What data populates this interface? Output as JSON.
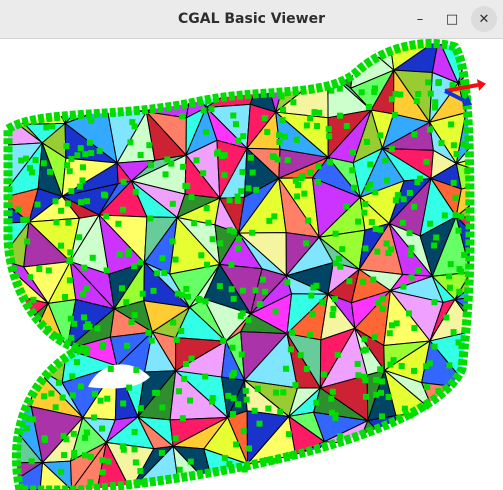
{
  "window": {
    "title": "CGAL Basic Viewer",
    "minimize_glyph": "–",
    "maximize_glyph": "□",
    "close_glyph": "✕"
  },
  "scene": {
    "background": "#ffffff",
    "mesh_edge_color": "#000000",
    "vertex_color": "#00dd00",
    "axes": {
      "x_color": "#ee1111",
      "y_color": "#1133dd"
    }
  }
}
